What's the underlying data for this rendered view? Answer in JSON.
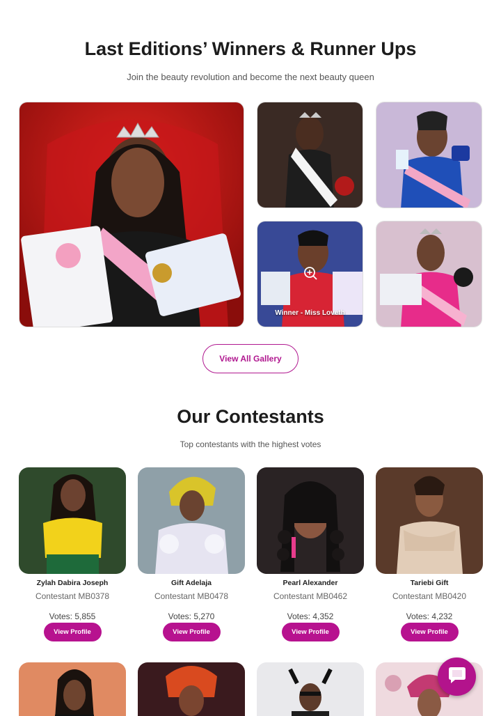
{
  "gallery": {
    "title": "Last Editions’ Winners & Runner Ups",
    "subtitle": "Join the beauty revolution and become the next beauty queen",
    "featured_caption": "Winner - Miss Loveth",
    "view_all_label": "View All Gallery",
    "photos": [
      {
        "name": "winner-main-photo",
        "theme": "red throne winner"
      },
      {
        "name": "miss-culture-photo",
        "theme": "miss culture sash"
      },
      {
        "name": "winner-blue-photo",
        "theme": "winner blue shirt"
      },
      {
        "name": "winner-miss-loveth-photo",
        "theme": "winner red shirt"
      },
      {
        "name": "winner-pink-photo",
        "theme": "winner pink outfit"
      }
    ]
  },
  "contestants": {
    "title": "Our Contestants",
    "subtitle": "Top contestants with the highest votes",
    "view_profile_label": "View Profile",
    "items": [
      {
        "name": "Zylah Dabira Joseph",
        "code": "Contestant MB0378",
        "votes": "Votes: 5,855"
      },
      {
        "name": "Gift Adelaja",
        "code": "Contestant MB0478",
        "votes": "Votes: 5,270"
      },
      {
        "name": "Pearl Alexander",
        "code": "Contestant MB0462",
        "votes": "Votes: 4,352"
      },
      {
        "name": "Tariebi Gift",
        "code": "Contestant MB0420",
        "votes": "Votes: 4,232"
      }
    ]
  },
  "colors": {
    "accent": "#b7128f",
    "heading": "#1c1c1c"
  },
  "icons": {
    "zoom": "zoom-in-icon",
    "chat": "chat-bubble-icon"
  }
}
